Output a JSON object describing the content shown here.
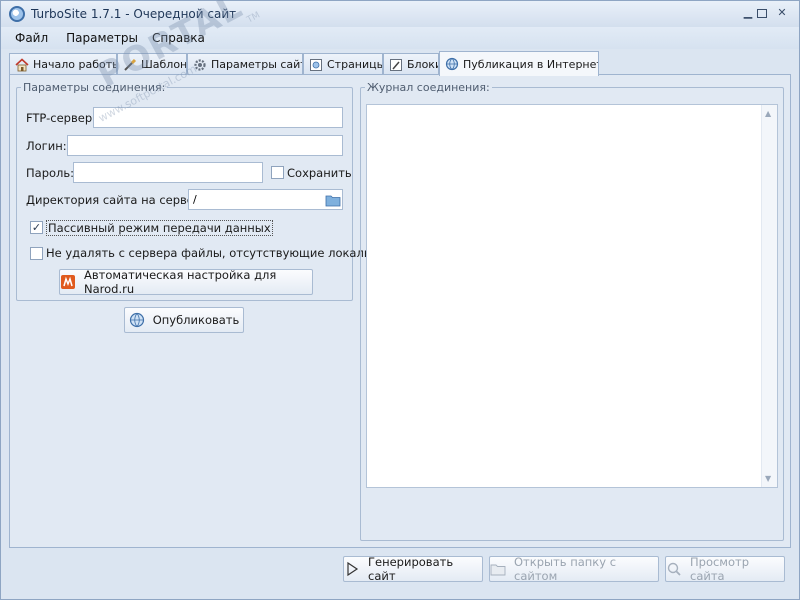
{
  "window": {
    "title": "TurboSite 1.7.1 - Очередной сайт"
  },
  "menu": [
    "Файл",
    "Параметры",
    "Справка"
  ],
  "tabs": [
    {
      "label": "Начало работы",
      "icon": "home-icon"
    },
    {
      "label": "Шаблон",
      "icon": "brush-icon"
    },
    {
      "label": "Параметры сайта",
      "icon": "gear-icon"
    },
    {
      "label": "Страницы",
      "icon": "pages-icon"
    },
    {
      "label": "Блоки",
      "icon": "pencil-icon"
    },
    {
      "label": "Публикация в Интернете",
      "icon": "globe-icon",
      "active": true
    }
  ],
  "connection": {
    "legend": "Параметры соединения:",
    "ftp_label": "FTP-сервер:",
    "ftp_value": "",
    "login_label": "Логин:",
    "login_value": "",
    "password_label": "Пароль:",
    "password_value": "",
    "save_label": "Сохранить",
    "save_checked": false,
    "dir_label": "Директория сайта на сервере:",
    "dir_value": "/",
    "passive_label": "Пассивный режим передачи данных",
    "passive_checked": true,
    "nodelete_label": "Не удалять с сервера файлы, отсутствующие локально",
    "nodelete_checked": false,
    "narod_button": "Автоматическая настройка для Narod.ru"
  },
  "publish_button": "Опубликовать",
  "log": {
    "legend": "Журнал соединения:"
  },
  "bottom": {
    "generate": "Генерировать сайт",
    "open_folder": "Открыть папку с сайтом",
    "preview": "Просмотр сайта"
  },
  "watermark": {
    "text": "PORTAL",
    "url": "www.softportal.com",
    "mark": "TM"
  },
  "colors": {
    "accent": "#3e6fa8",
    "window_bg": "#dbe5f1",
    "disabled_text": "#9aa4b0"
  }
}
